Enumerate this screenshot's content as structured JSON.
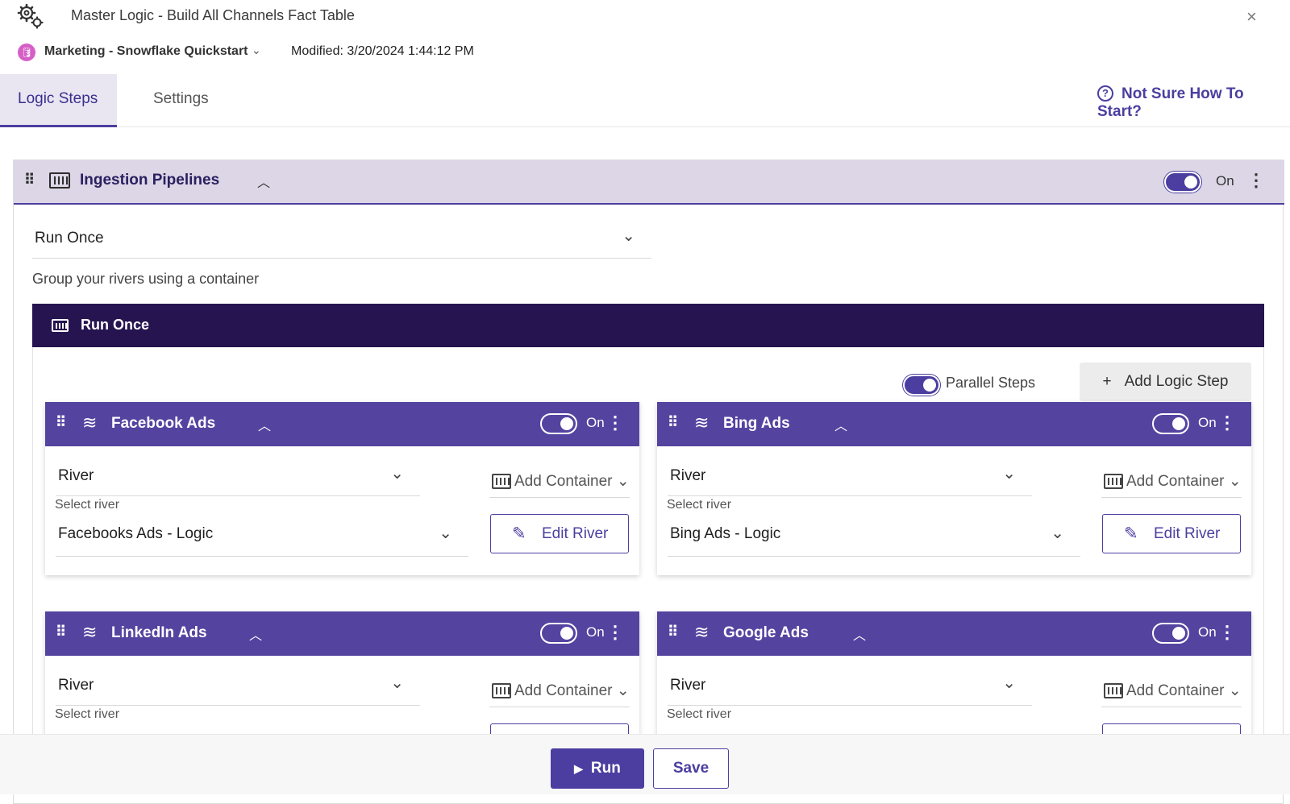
{
  "window": {
    "title": "Master Logic - Build All Channels Fact Table",
    "close_icon": "×"
  },
  "env": {
    "name": "Marketing - Snowflake Quickstart",
    "modified": "Modified: 3/20/2024 1:44:12 PM"
  },
  "tabs": [
    {
      "label": "Logic Steps",
      "active": true
    },
    {
      "label": "Settings",
      "active": false
    }
  ],
  "help": {
    "label": "Not Sure How To Start?"
  },
  "ingestion": {
    "title": "Ingestion Pipelines",
    "toggle_label": "On",
    "run_mode": "Run Once",
    "group_hint": "Group your rivers using a container",
    "container_title": "Run Once",
    "parallel_label": "Parallel Steps",
    "add_step_label": "Add Logic Step"
  },
  "rivers": [
    {
      "title": "Facebook Ads",
      "toggle": "On",
      "type": "River",
      "add_container": "Add Container",
      "select_label": "Select river",
      "river": "Facebooks Ads - Logic",
      "edit_label": "Edit River"
    },
    {
      "title": "Bing Ads",
      "toggle": "On",
      "type": "River",
      "add_container": "Add Container",
      "select_label": "Select river",
      "river": "Bing Ads - Logic",
      "edit_label": "Edit River"
    },
    {
      "title": "LinkedIn Ads",
      "toggle": "On",
      "type": "River",
      "add_container": "Add Container",
      "select_label": "Select river",
      "river": "",
      "edit_label": ""
    },
    {
      "title": "Google Ads",
      "toggle": "On",
      "type": "River",
      "add_container": "Add Container",
      "select_label": "Select river",
      "river": "",
      "edit_label": ""
    }
  ],
  "footer": {
    "run_label": "Run",
    "save_label": "Save"
  },
  "colors": {
    "accent": "#4b3ea0",
    "dark_header": "#261450",
    "card_header": "#5444a0",
    "group_header": "#dcd6e6"
  }
}
